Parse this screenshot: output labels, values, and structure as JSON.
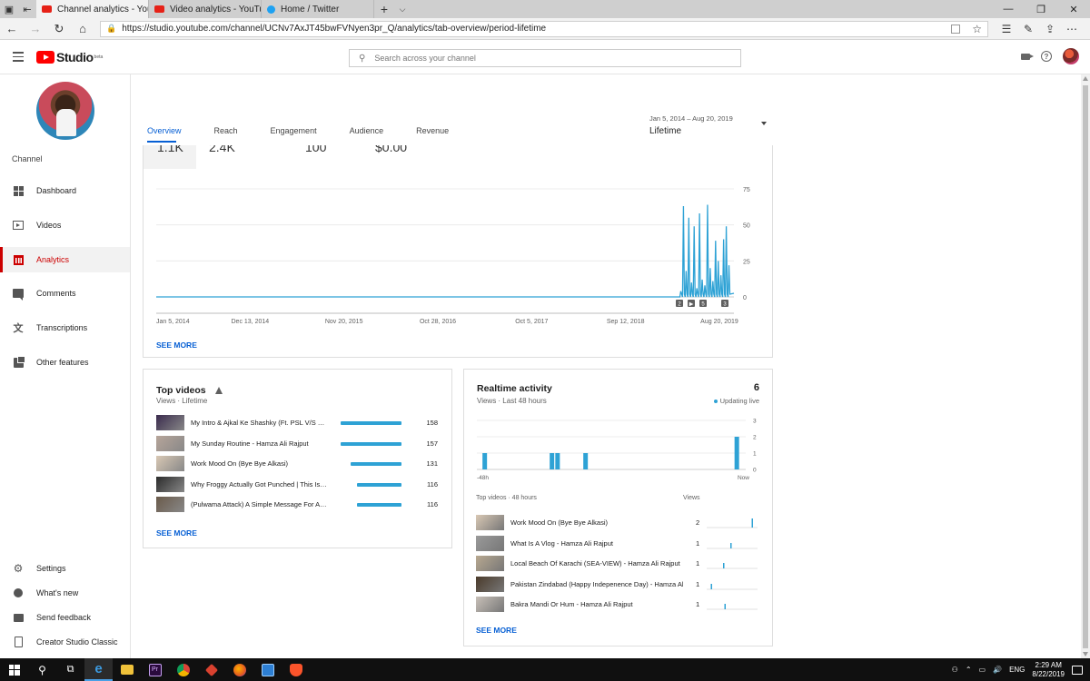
{
  "browser": {
    "tabs": [
      {
        "title": "Channel analytics - You'",
        "active": true,
        "favicon": "youtube-icon"
      },
      {
        "title": "Video analytics - YouTube S",
        "active": false,
        "favicon": "youtube-icon"
      },
      {
        "title": "Home / Twitter",
        "active": false,
        "favicon": "twitter-icon"
      }
    ],
    "url": "https://studio.youtube.com/channel/UCNv7AxJT45bwFVNyen3pr_Q/analytics/tab-overview/period-lifetime"
  },
  "header": {
    "logo_text": "Studio",
    "logo_badge": "beta",
    "search_placeholder": "Search across your channel"
  },
  "sidebar": {
    "channel_label": "Channel",
    "items": [
      {
        "label": "Dashboard",
        "icon": "dashboard-icon"
      },
      {
        "label": "Videos",
        "icon": "videos-icon"
      },
      {
        "label": "Analytics",
        "icon": "analytics-icon",
        "active": true
      },
      {
        "label": "Comments",
        "icon": "comments-icon"
      },
      {
        "label": "Transcriptions",
        "icon": "translate-icon"
      },
      {
        "label": "Other features",
        "icon": "other-features-icon"
      }
    ],
    "bottom_items": [
      {
        "label": "Settings",
        "icon": "gear-icon"
      },
      {
        "label": "What's new",
        "icon": "bulb-icon"
      },
      {
        "label": "Send feedback",
        "icon": "feedback-icon"
      },
      {
        "label": "Creator Studio Classic",
        "icon": "classic-icon"
      }
    ]
  },
  "analytics": {
    "tabs": [
      "Overview",
      "Reach",
      "Engagement",
      "Audience",
      "Revenue"
    ],
    "active_tab": "Overview",
    "date_range": {
      "sub": "Jan 5, 2014 – Aug 20, 2019",
      "label": "Lifetime"
    },
    "metrics": [
      "1.1K",
      "2.4K",
      "100",
      "$0.00"
    ],
    "chart_data": {
      "type": "line",
      "x_ticks": [
        "Jan 5, 2014",
        "Dec 13, 2014",
        "Nov 20, 2015",
        "Oct 28, 2016",
        "Oct 5, 2017",
        "Sep 12, 2018",
        "Aug 20, 2019"
      ],
      "y_ticks": [
        75,
        50,
        25,
        0
      ],
      "ylim": [
        0,
        75
      ],
      "grid": true,
      "series_color": "#2ea2d5",
      "baseline": 0,
      "spikes": [
        {
          "x": "Mar 2019",
          "y": 4
        },
        {
          "x": "Apr 2019",
          "y": 63
        },
        {
          "x": "Apr 2019",
          "y": 18
        },
        {
          "x": "Apr 2019",
          "y": 55
        },
        {
          "x": "May 2019",
          "y": 10
        },
        {
          "x": "May 2019",
          "y": 49
        },
        {
          "x": "May 2019",
          "y": 6
        },
        {
          "x": "May 2019",
          "y": 58
        },
        {
          "x": "Jun 2019",
          "y": 12
        },
        {
          "x": "Jun 2019",
          "y": 8
        },
        {
          "x": "Jun 2019",
          "y": 64
        },
        {
          "x": "Jun 2019",
          "y": 20
        },
        {
          "x": "Jul 2019",
          "y": 11
        },
        {
          "x": "Jul 2019",
          "y": 39
        },
        {
          "x": "Jul 2019",
          "y": 25
        },
        {
          "x": "Aug 2019",
          "y": 15
        },
        {
          "x": "Aug 2019",
          "y": 40
        },
        {
          "x": "Aug 2019",
          "y": 49
        },
        {
          "x": "Aug 2019",
          "y": 22
        }
      ],
      "markers": [
        "2",
        "▶",
        "5",
        "3"
      ]
    },
    "see_more": "SEE MORE"
  },
  "top_videos": {
    "title": "Top videos",
    "sub": "Views · Lifetime",
    "max": 158,
    "rows": [
      {
        "title": "My Intro & Ajkal Ke Shashky (Ft. PSL V/S Va...",
        "views": 158
      },
      {
        "title": "My Sunday Routine - Hamza Ali Rajput",
        "views": 157
      },
      {
        "title": "Work Mood On (Bye Bye Alkasi)",
        "views": 131
      },
      {
        "title": "Why Froggy Actually Got Punched | This Is ...",
        "views": 116
      },
      {
        "title": "(Pulwama Attack) A Simple Message For Al...",
        "views": 116
      }
    ],
    "see_more": "SEE MORE"
  },
  "realtime": {
    "title": "Realtime activity",
    "count": "6",
    "sub": "Views · Last 48 hours",
    "live_label": "Updating live",
    "live_color": "#2ea2d5",
    "chart_data": {
      "type": "bar",
      "x_labels": [
        "-48h",
        "Now"
      ],
      "y_ticks": [
        3,
        2,
        1,
        0
      ],
      "ylim": [
        0,
        3
      ],
      "bars": [
        {
          "hour": -47,
          "value": 1
        },
        {
          "hour": -35,
          "value": 1
        },
        {
          "hour": -34,
          "value": 1
        },
        {
          "hour": -29,
          "value": 1
        },
        {
          "hour": -2,
          "value": 2
        }
      ]
    },
    "list_header": {
      "left": "Top videos · 48 hours",
      "right": "Views"
    },
    "rows": [
      {
        "title": "Work Mood On (Bye Bye Alkasi)",
        "views": 2,
        "spark": 0.95
      },
      {
        "title": "What Is A Vlog - Hamza Ali Rajput",
        "views": 1,
        "spark": 0.48
      },
      {
        "title": "Local Beach Of Karachi (SEA-VIEW) - Hamza Ali Rajput",
        "views": 1,
        "spark": 0.32
      },
      {
        "title": "Pakistan Zindabad (Happy Indepenence Day) - Hamza Ali R",
        "views": 1,
        "spark": 0.05
      },
      {
        "title": "Bakra Mandi Or Hum - Hamza Ali Rajput",
        "views": 1,
        "spark": 0.35
      }
    ],
    "see_more": "SEE MORE"
  },
  "taskbar": {
    "lang": "ENG",
    "time": "2:29 AM",
    "date": "8/22/2019"
  }
}
